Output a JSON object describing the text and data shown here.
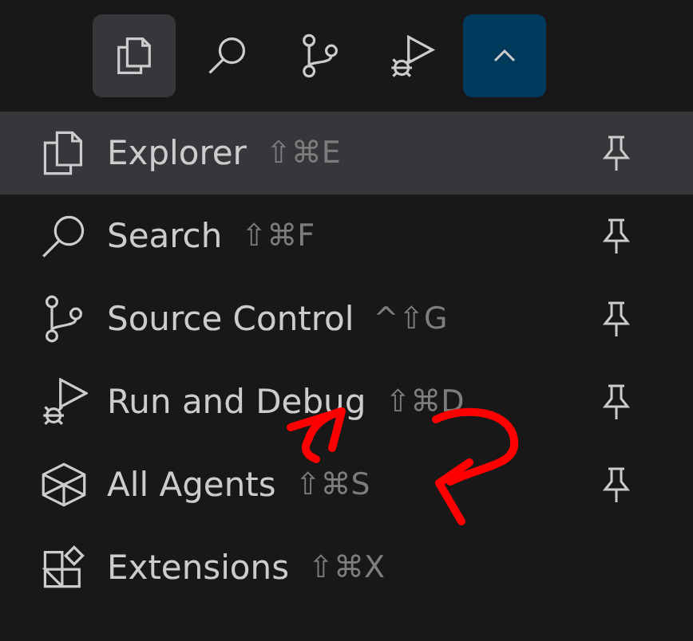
{
  "toolbar": [
    {
      "selected": true
    },
    {
      "selected": false
    },
    {
      "selected": false
    },
    {
      "selected": false
    },
    {
      "kind": "toggle"
    }
  ],
  "menu": [
    {
      "label": "Explorer",
      "shortcut": "⇧⌘E",
      "pinned": true,
      "selected": true
    },
    {
      "label": "Search",
      "shortcut": "⇧⌘F",
      "pinned": true,
      "selected": false
    },
    {
      "label": "Source Control",
      "shortcut": "^⇧G",
      "pinned": true,
      "selected": false
    },
    {
      "label": "Run and Debug",
      "shortcut": "⇧⌘D",
      "pinned": true,
      "selected": false
    },
    {
      "label": "All Agents",
      "shortcut": "⇧⌘S",
      "pinned": true,
      "selected": false
    },
    {
      "label": "Extensions",
      "shortcut": "⇧⌘X",
      "pinned": false,
      "selected": false
    }
  ]
}
